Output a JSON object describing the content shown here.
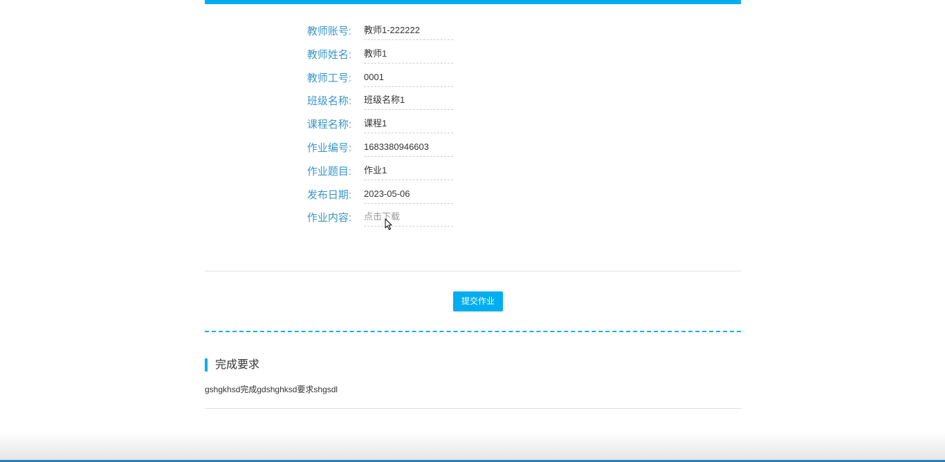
{
  "details": [
    {
      "label": "教师账号:",
      "value": "教师1-222222"
    },
    {
      "label": "教师姓名:",
      "value": "教师1"
    },
    {
      "label": "教师工号:",
      "value": "0001"
    },
    {
      "label": "班级名称:",
      "value": "班级名称1"
    },
    {
      "label": "课程名称:",
      "value": "课程1"
    },
    {
      "label": "作业编号:",
      "value": "1683380946603"
    },
    {
      "label": "作业题目:",
      "value": "作业1"
    },
    {
      "label": "发布日期:",
      "value": "2023-05-06"
    },
    {
      "label": "作业内容:",
      "value": "点击下载"
    }
  ],
  "actions": {
    "submit_label": "提交作业"
  },
  "requirements": {
    "title": "完成要求",
    "content": "gshgkhsd完成gdshghksd要求shgsdl"
  },
  "colors": {
    "accent": "#00aeef",
    "label": "#3a96c9"
  }
}
